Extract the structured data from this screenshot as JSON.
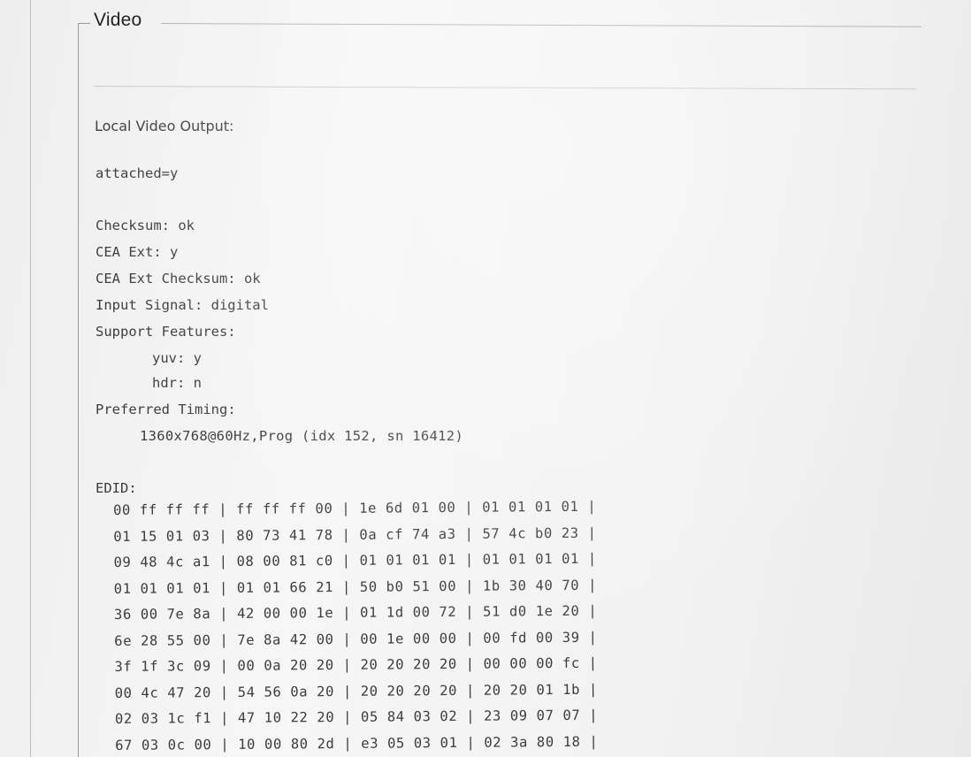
{
  "section": {
    "legend": "Video"
  },
  "video": {
    "heading": "Local Video Output:",
    "attached": "attached=y",
    "checksum": "Checksum: ok",
    "cea_ext": "CEA Ext: y",
    "cea_ext_checksum": "CEA Ext Checksum: ok",
    "input_signal": "Input Signal: digital",
    "support_features_label": "Support Features:",
    "features": {
      "yuv": "yuv: y",
      "hdr": "hdr: n"
    },
    "preferred_timing_label": "Preferred Timing:",
    "preferred_timing_value": "1360x768@60Hz,Prog (idx 152, sn 16412)"
  },
  "edid": {
    "label": "EDID:",
    "rows": [
      "00 ff ff ff | ff ff ff 00 | 1e 6d 01 00 | 01 01 01 01 |",
      "01 15 01 03 | 80 73 41 78 | 0a cf 74 a3 | 57 4c b0 23 |",
      "09 48 4c a1 | 08 00 81 c0 | 01 01 01 01 | 01 01 01 01 |",
      "01 01 01 01 | 01 01 66 21 | 50 b0 51 00 | 1b 30 40 70 |",
      "36 00 7e 8a | 42 00 00 1e | 01 1d 00 72 | 51 d0 1e 20 |",
      "6e 28 55 00 | 7e 8a 42 00 | 00 1e 00 00 | 00 fd 00 39 |",
      "3f 1f 3c 09 | 00 0a 20 20 | 20 20 20 20 | 00 00 00 fc |",
      "00 4c 47 20 | 54 56 0a 20 | 20 20 20 20 | 20 20 01 1b |",
      "02 03 1c f1 | 47 10 22 20 | 05 84 03 02 | 23 09 07 07 |",
      "67 03 0c 00 | 10 00 80 2d | e3 05 03 01 | 02 3a 80 18 |"
    ]
  }
}
